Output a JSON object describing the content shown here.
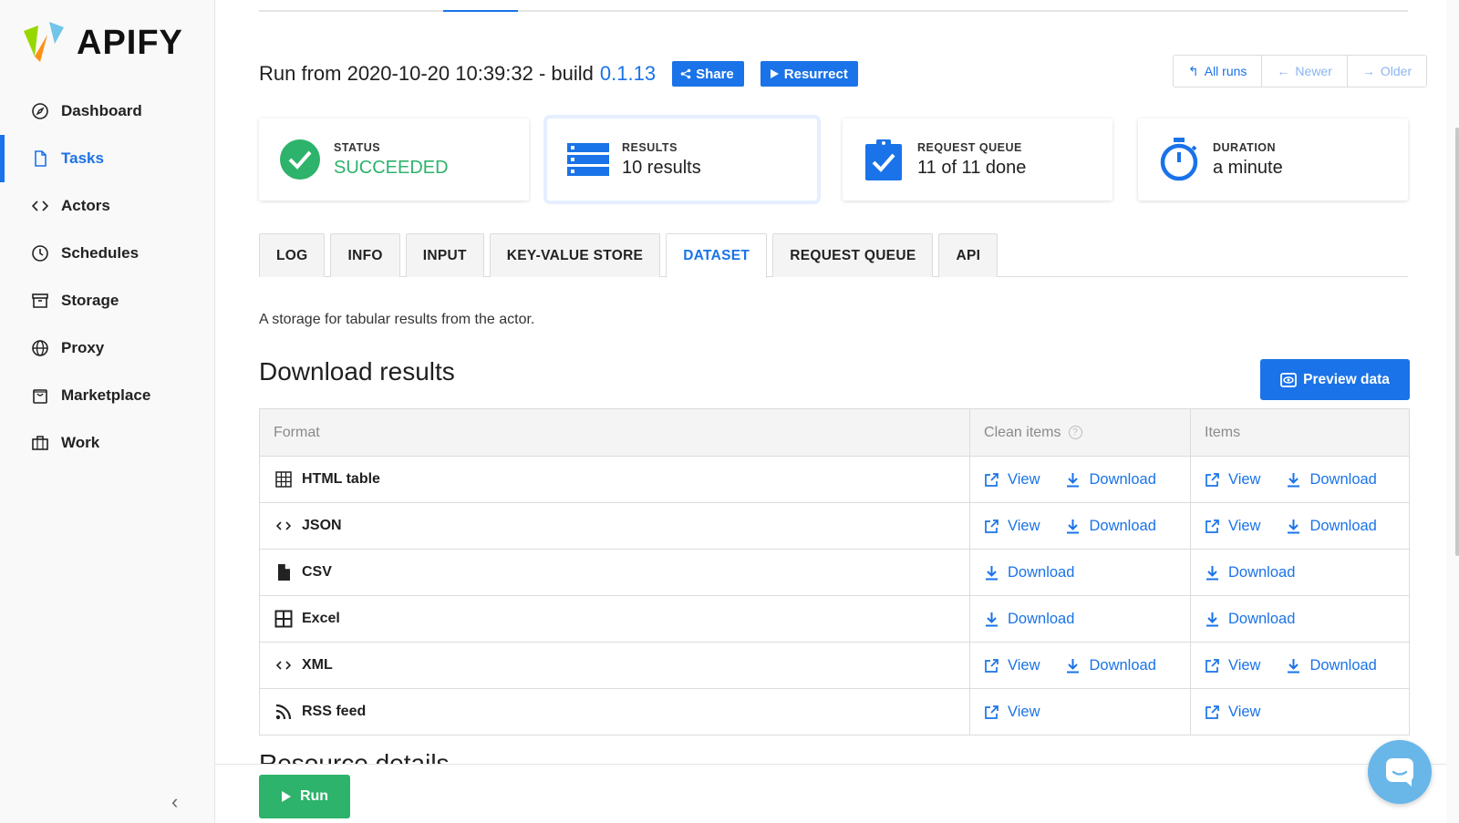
{
  "app": {
    "name": "APIFY"
  },
  "sidebar": {
    "items": [
      {
        "label": "Dashboard",
        "icon": "compass-icon"
      },
      {
        "label": "Tasks",
        "icon": "document-icon",
        "active": true
      },
      {
        "label": "Actors",
        "icon": "code-icon"
      },
      {
        "label": "Schedules",
        "icon": "clock-icon"
      },
      {
        "label": "Storage",
        "icon": "archive-icon"
      },
      {
        "label": "Proxy",
        "icon": "globe-icon"
      },
      {
        "label": "Marketplace",
        "icon": "shopping-bag-icon"
      },
      {
        "label": "Work",
        "icon": "briefcase-icon"
      }
    ],
    "collapse_label": "‹"
  },
  "header": {
    "title_prefix": "Run from 2020-10-20 10:39:32 - build",
    "build": "0.1.13",
    "share_label": "Share",
    "resurrect_label": "Resurrect",
    "nav": {
      "all_runs": "All runs",
      "newer": "Newer",
      "older": "Older"
    }
  },
  "stats": {
    "status": {
      "label": "STATUS",
      "value": "SUCCEEDED"
    },
    "results": {
      "label": "RESULTS",
      "value": "10 results"
    },
    "queue": {
      "label": "REQUEST QUEUE",
      "value": "11 of 11 done"
    },
    "duration": {
      "label": "DURATION",
      "value": "a minute"
    }
  },
  "tabs": [
    "LOG",
    "INFO",
    "INPUT",
    "KEY-VALUE STORE",
    "DATASET",
    "REQUEST QUEUE",
    "API"
  ],
  "active_tab": "DATASET",
  "dataset": {
    "description": "A storage for tabular results from the actor.",
    "section_title": "Download results",
    "preview_label": "Preview data",
    "table": {
      "headers": {
        "format": "Format",
        "clean": "Clean items",
        "items": "Items"
      },
      "help_glyph": "?",
      "view_label": "View",
      "download_label": "Download",
      "rows": [
        {
          "format": "HTML table",
          "icon": "table-grid-icon"
        },
        {
          "format": "JSON",
          "icon": "code-icon"
        },
        {
          "format": "CSV",
          "icon": "file-icon"
        },
        {
          "format": "Excel",
          "icon": "spreadsheet-icon"
        },
        {
          "format": "XML",
          "icon": "code-icon"
        },
        {
          "format": "RSS feed",
          "icon": "rss-icon"
        }
      ]
    }
  },
  "footer": {
    "partial_heading": "Resource details",
    "run_label": "Run"
  },
  "colors": {
    "accent": "#1a73e8",
    "success": "#2db36b",
    "chat": "#69b6e8"
  }
}
